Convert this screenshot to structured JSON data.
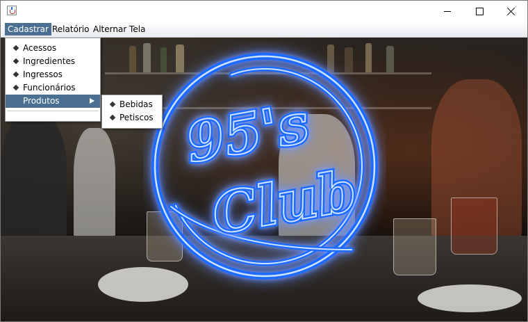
{
  "window": {
    "title": ""
  },
  "menubar": {
    "items": [
      {
        "label": "Cadastrar"
      },
      {
        "label": "Relatório"
      },
      {
        "label": "Alternar Tela"
      }
    ]
  },
  "cadastrar_menu": {
    "items": [
      {
        "label": "Acessos"
      },
      {
        "label": "Ingredientes"
      },
      {
        "label": "Ingressos"
      },
      {
        "label": "Funcionários"
      },
      {
        "label": "Produtos"
      }
    ]
  },
  "produtos_submenu": {
    "items": [
      {
        "label": "Bebidas"
      },
      {
        "label": "Petiscos"
      }
    ]
  },
  "logo": {
    "top_text": "95's",
    "bottom_text": "Club"
  },
  "colors": {
    "menu_highlight": "#4a6f91",
    "neon_blue": "#1f6bff",
    "neon_core": "#cfe2ff"
  },
  "icons": {
    "app": "java-cup-icon",
    "minimize": "minimize-icon",
    "maximize": "maximize-icon",
    "close": "close-icon",
    "submenu": "submenu-arrow-icon"
  }
}
